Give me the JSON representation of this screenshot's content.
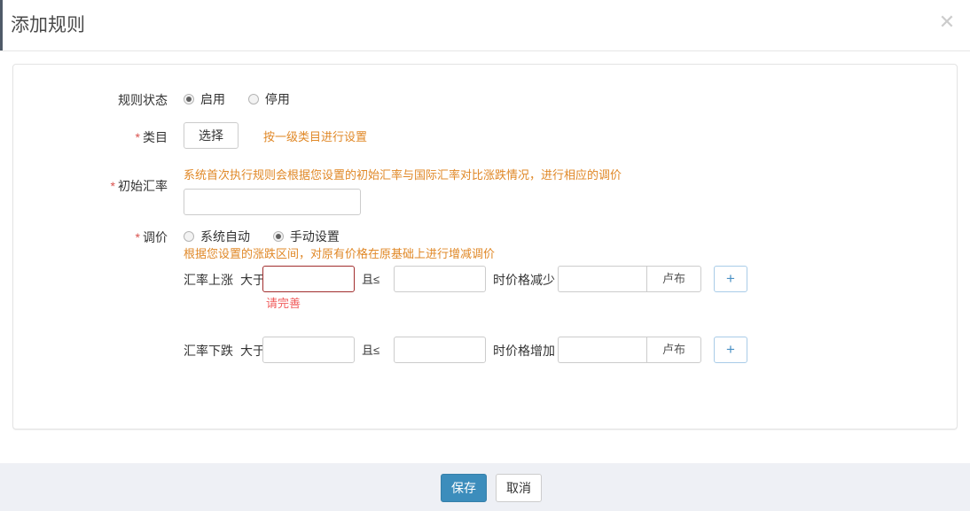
{
  "header": {
    "title": "添加规则",
    "close_icon": "close-icon"
  },
  "form": {
    "rule_status": {
      "label": "规则状态",
      "required": false,
      "options": [
        {
          "label": "启用",
          "selected": true
        },
        {
          "label": "停用",
          "selected": false
        }
      ]
    },
    "category": {
      "label": "类目",
      "required": true,
      "required_mark": "*",
      "select_button": "选择",
      "hint": "按一级类目进行设置"
    },
    "initial_rate": {
      "label": "初始汇率",
      "required": true,
      "required_mark": "*",
      "hint": "系统首次执行规则会根据您设置的初始汇率与国际汇率对比涨跌情况，进行相应的调价",
      "value": "",
      "placeholder": ""
    },
    "price_adjust": {
      "label": "调价",
      "required": true,
      "required_mark": "*",
      "options": [
        {
          "label": "系统自动",
          "selected": false
        },
        {
          "label": "手动设置",
          "selected": true
        }
      ],
      "hint": "根据您设置的涨跌区间，对原有价格在原基础上进行增减调价",
      "rows": [
        {
          "direction_label": "汇率上涨",
          "gt_label": "大于",
          "gt_value": "",
          "gt_error": true,
          "lte_label": "且≤",
          "lte_value": "",
          "effect_label": "时价格减少",
          "amount_value": "",
          "unit": "卢布",
          "add_button": "+",
          "error_text": "请完善"
        },
        {
          "direction_label": "汇率下跌",
          "gt_label": "大于",
          "gt_value": "",
          "gt_error": false,
          "lte_label": "且≤",
          "lte_value": "",
          "effect_label": "时价格增加",
          "amount_value": "",
          "unit": "卢布",
          "add_button": "+",
          "error_text": ""
        }
      ]
    }
  },
  "footer": {
    "save_label": "保存",
    "cancel_label": "取消"
  },
  "colors": {
    "primary": "#3c8dbc",
    "hint": "#e08827",
    "error": "#f05c5c",
    "error_border": "#a12d2d",
    "footer_bg": "#eef0f5"
  }
}
